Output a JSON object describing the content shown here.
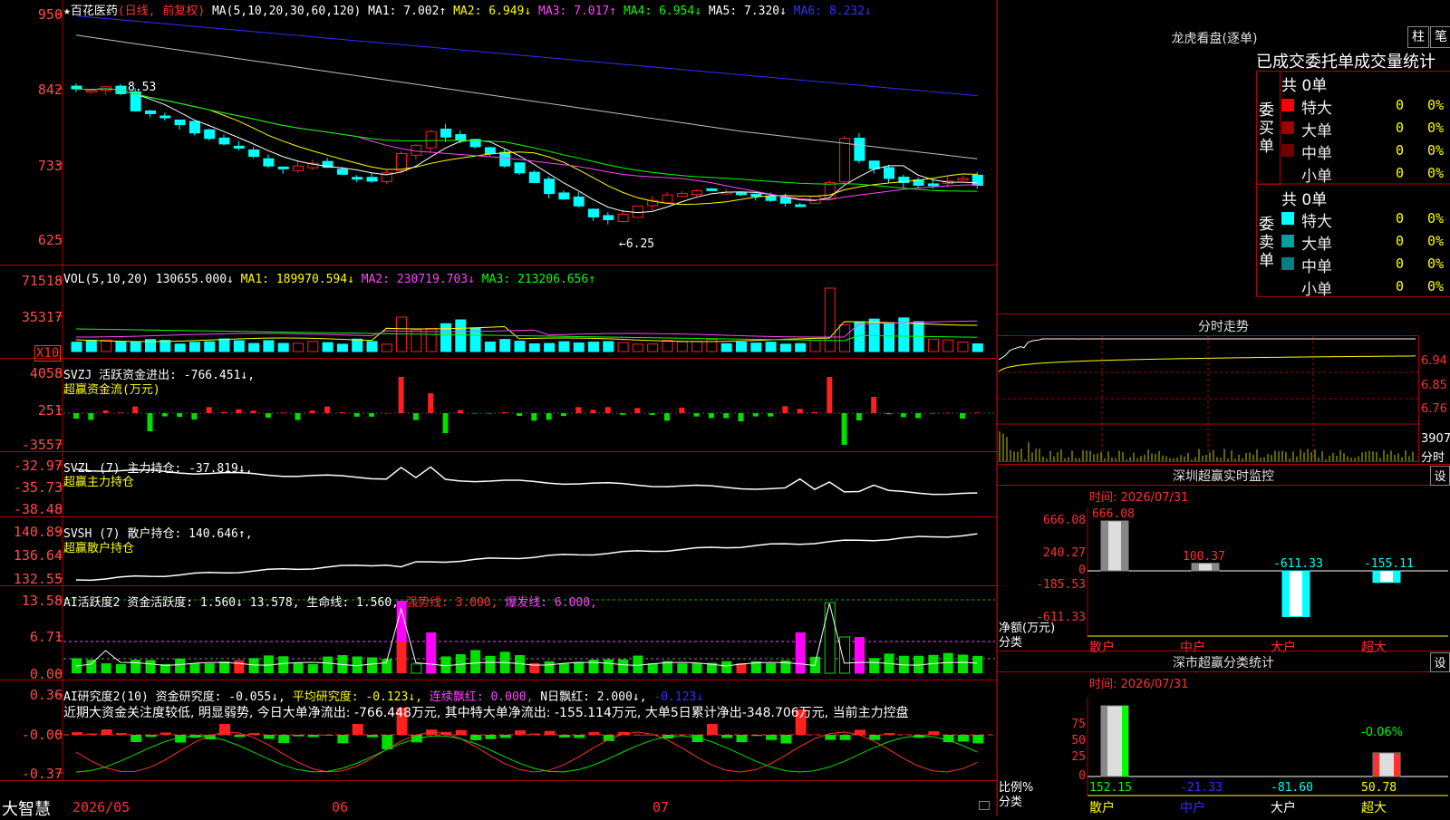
{
  "colors": {
    "up": "#ff2020",
    "down": "#00ffff",
    "bg": "#000000",
    "grid": "#b00000",
    "ma1": "#ffffff",
    "ma2": "#ffff00",
    "ma3": "#ff44ff",
    "ma4": "#00ff00",
    "ma5": "#c0c0c0",
    "ma6": "#3030ff"
  },
  "main": {
    "title": "★百花医药",
    "mode": "(日线, 前复权)",
    "ma_label": "MA(5,10,20,30,60,120)",
    "ma1": "MA1: 7.002↑",
    "ma2": "MA2: 6.949↓",
    "ma3": "MA3: 7.017↑",
    "ma4": "MA4: 6.954↓",
    "ma5": "MA5: 7.320↓",
    "ma6": "MA6: 8.232↓",
    "ticks": [
      "950",
      "842",
      "733",
      "625"
    ],
    "high_label": "8.53",
    "low_label": "←6.25",
    "x10": "X10"
  },
  "vol": {
    "label": "VOL(5,10,20)",
    "v": "130655.000↓",
    "ma1": "MA1: 189970.594↓",
    "ma2": "MA2: 230719.703↓",
    "ma3": "MA3: 213206.656↑",
    "ticks": [
      "71518",
      "35317"
    ]
  },
  "svzj": {
    "label": "SVZJ  活跃资金进出: -766.451↓,",
    "sub": "超赢资金流(万元)",
    "ticks": [
      "4058",
      "251",
      "-3557"
    ]
  },
  "svzl": {
    "label": "SVZL (7) 主力持仓: -37.819↓,",
    "sub": "超赢主力持仓",
    "ticks": [
      "-32.97",
      "-35.73",
      "-38.48"
    ]
  },
  "svsh": {
    "label": "SVSH (7) 散户持仓: 140.646↑,",
    "sub": "超赢散户持仓",
    "ticks": [
      "140.89",
      "136.64",
      "132.55"
    ]
  },
  "ai1": {
    "a": "AI活跃度2 资金活跃度: 1.560↓",
    "b": "13.578,",
    "c": "生命线: 1.560,",
    "d": "强势线: 3.000,",
    "e": "爆发线: 6.000,",
    "ticks": [
      "13.58",
      "6.71",
      "0.00"
    ]
  },
  "ai2": {
    "a": "AI研究度2(10) 资金研究度: -0.055↓,",
    "b": "平均研究度: -0.123↓,",
    "c": "连续飘红: 0.000,",
    "d": "N日飘红: 2.000↓,",
    "e": "-0.123↓",
    "text": "近期大资金关注度较低, 明显弱势, 今日大单净流出: -766.448万元, 其中特大单净流出: -155.114万元, 大单5日累计净出-348.706万元, 当前主力控盘",
    "ticks": [
      "0.36",
      "-0.00",
      "-0.37"
    ]
  },
  "bottom": {
    "brand": "大智慧",
    "dates": [
      "2026/05",
      "06",
      "07"
    ]
  },
  "dragon": {
    "title": "龙虎看盘(逐单)",
    "btn1": "柱",
    "btn2": "笔",
    "header": "已成交委托单成交量统计",
    "buy_label": "委买单",
    "sell_label": "委卖单",
    "buy_total": "共 0单",
    "sell_total": "共 0单",
    "buy": [
      {
        "name": "特大",
        "n": "0",
        "p": "0%",
        "c": "#ff0000"
      },
      {
        "name": "大单",
        "n": "0",
        "p": "0%",
        "c": "#a00000"
      },
      {
        "name": "中单",
        "n": "0",
        "p": "0%",
        "c": "#700000"
      },
      {
        "name": "小单",
        "n": "0",
        "p": "0%",
        "c": "#000000"
      }
    ],
    "sell": [
      {
        "name": "特大",
        "n": "0",
        "p": "0%",
        "c": "#00ffff"
      },
      {
        "name": "大单",
        "n": "0",
        "p": "0%",
        "c": "#00a0a0"
      },
      {
        "name": "中单",
        "n": "0",
        "p": "0%",
        "c": "#008080"
      },
      {
        "name": "小单",
        "n": "0",
        "p": "0%",
        "c": "#000000"
      }
    ]
  },
  "fenshi": {
    "title": "分时走势",
    "ticks": [
      "6.94",
      "6.85",
      "6.76"
    ],
    "vol": "3907",
    "unit": "分时"
  },
  "sz": {
    "title": "深圳超赢实时监控",
    "btn": "设",
    "time": "时间: 2026/07/31",
    "ylabels": [
      "666.08",
      "240.27",
      "0",
      "-185.53",
      "-611.33"
    ],
    "unit": "净额(万元)",
    "cat": "分类",
    "bars": [
      {
        "name": "散户",
        "value": 666.08,
        "label": "666.08"
      },
      {
        "name": "中户",
        "value": 100.37,
        "label": "100.37"
      },
      {
        "name": "大户",
        "value": -611.33,
        "label": "-611.33"
      },
      {
        "name": "超大",
        "value": -155.11,
        "label": "-155.11"
      }
    ]
  },
  "sc": {
    "title": "深市超赢分类统计",
    "btn": "设",
    "time": "时间: 2026/07/31",
    "ylabels": [
      "75",
      "50",
      "25",
      "0"
    ],
    "unit": "比例%",
    "cat": "分类",
    "top_label": "-0.06%",
    "bars": [
      {
        "name": "散户",
        "value": 152.15,
        "label": "152.15"
      },
      {
        "name": "中户",
        "value": -21.33,
        "label": "-21.33"
      },
      {
        "name": "大户",
        "value": -81.6,
        "label": "-81.60"
      },
      {
        "name": "超大",
        "value": 50.78,
        "label": "50.78"
      }
    ]
  }
}
